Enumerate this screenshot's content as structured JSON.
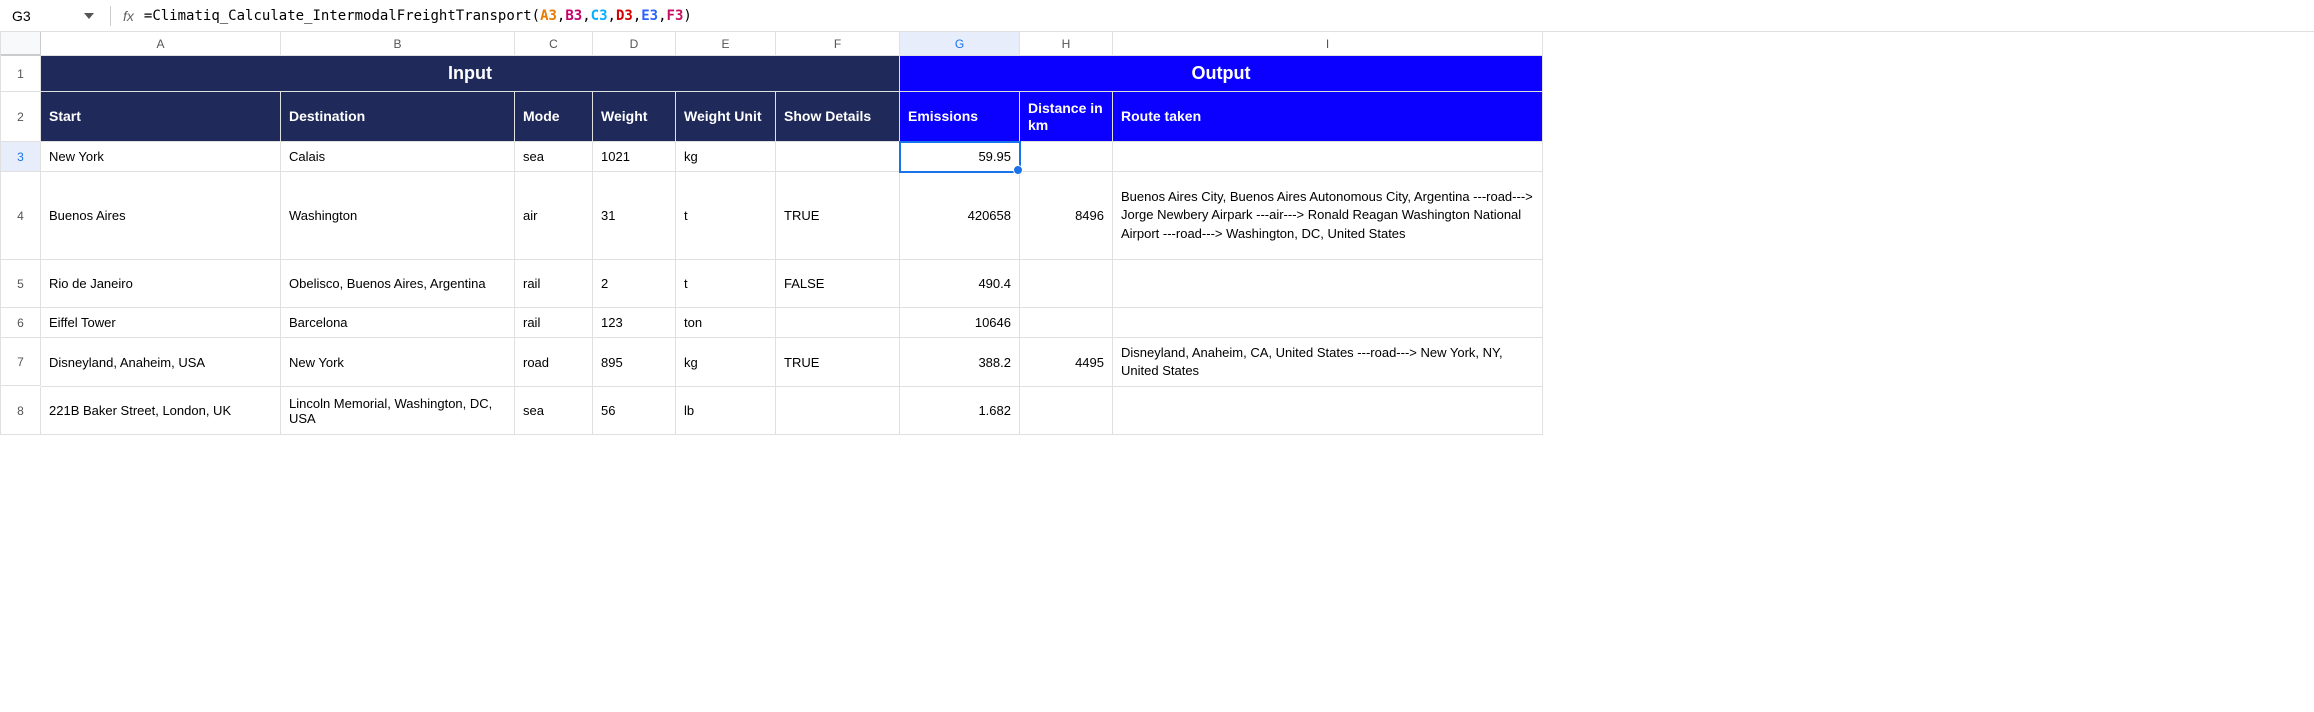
{
  "name_box": "G3",
  "formula": {
    "prefix": "=",
    "fn": "Climatiq_Calculate_IntermodalFreightTransport",
    "args": [
      "A3",
      "B3",
      "C3",
      "D3",
      "E3",
      "F3"
    ]
  },
  "columns": [
    "A",
    "B",
    "C",
    "D",
    "E",
    "F",
    "G",
    "H",
    "I"
  ],
  "row_nums": [
    "1",
    "2",
    "3",
    "4",
    "5",
    "6",
    "7",
    "8"
  ],
  "selected_col": "G",
  "selected_row": "3",
  "section_headers": {
    "input": "Input",
    "output": "Output"
  },
  "headers": {
    "start": "Start",
    "destination": "Destination",
    "mode": "Mode",
    "weight": "Weight",
    "weight_unit": "Weight Unit",
    "show_details": "Show Details",
    "emissions": "Emissions",
    "distance": "Distance in km",
    "route": "Route taken"
  },
  "rows": [
    {
      "start": "New York",
      "dest": "Calais",
      "mode": "sea",
      "weight": "1021",
      "unit": "kg",
      "details": "",
      "emissions": "59.95",
      "distance": "",
      "route": ""
    },
    {
      "start": "Buenos Aires",
      "dest": "Washington",
      "mode": "air",
      "weight": "31",
      "unit": "t",
      "details": "TRUE",
      "emissions": "420658",
      "distance": "8496",
      "route": "Buenos Aires City, Buenos Aires Autonomous City, Argentina ---road---> Jorge Newbery Airpark ---air---> Ronald Reagan Washington National Airport ---road---> Washington, DC, United States"
    },
    {
      "start": "Rio de Janeiro",
      "dest": "Obelisco, Buenos Aires, Argentina",
      "mode": "rail",
      "weight": "2",
      "unit": "t",
      "details": "FALSE",
      "emissions": "490.4",
      "distance": "",
      "route": ""
    },
    {
      "start": "Eiffel Tower",
      "dest": "Barcelona",
      "mode": "rail",
      "weight": "123",
      "unit": "ton",
      "details": "",
      "emissions": "10646",
      "distance": "",
      "route": ""
    },
    {
      "start": "Disneyland, Anaheim, USA",
      "dest": "New York",
      "mode": "road",
      "weight": "895",
      "unit": "kg",
      "details": "TRUE",
      "emissions": "388.2",
      "distance": "4495",
      "route": "Disneyland, Anaheim, CA, United States ---road---> New York, NY, United States"
    },
    {
      "start": "221B Baker Street, London, UK",
      "dest": "Lincoln Memorial, Washington, DC, USA",
      "mode": "sea",
      "weight": "56",
      "unit": "lb",
      "details": "",
      "emissions": "1.682",
      "distance": "",
      "route": ""
    }
  ]
}
